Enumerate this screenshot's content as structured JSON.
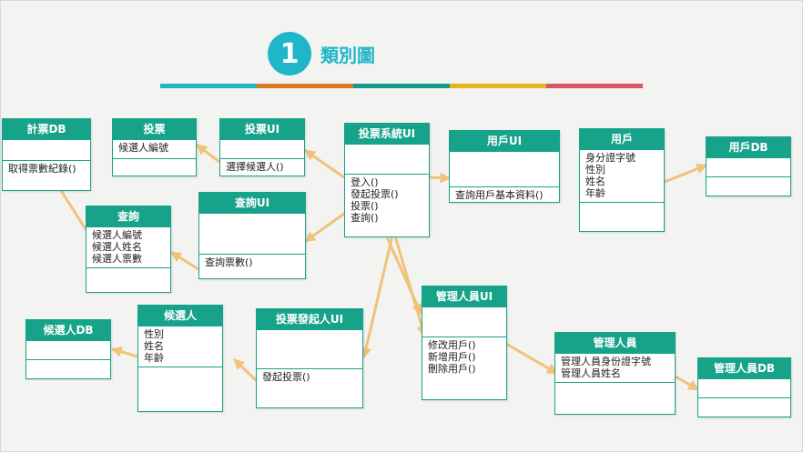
{
  "title": {
    "number": "1",
    "text": "類別圖"
  },
  "title_bar_colors": [
    "#1fb6c9",
    "#d97a1e",
    "#17998a",
    "#e5b51d",
    "#d9556a"
  ],
  "colors": {
    "class_header": "#17a389",
    "link_line": "#f0c27a"
  },
  "classes": {
    "jipiao_db": {
      "name": "計票DB",
      "attrs": [],
      "methods": [
        "取得票數紀錄()"
      ]
    },
    "toupiao": {
      "name": "投票",
      "attrs": [
        "候選人編號"
      ],
      "methods": []
    },
    "toupiao_ui": {
      "name": "投票UI",
      "attrs": [],
      "methods": [
        "選擇候選人()"
      ]
    },
    "toupiao_system": {
      "name": "投票系統UI",
      "attrs": [],
      "methods": [
        "登入()",
        "發起投票()",
        "投票()",
        "查詢()"
      ]
    },
    "yonghu_ui": {
      "name": "用戶UI",
      "attrs": [],
      "methods": [
        "查詢用戶基本資料()"
      ]
    },
    "yonghu": {
      "name": "用戶",
      "attrs": [
        "身分證字號",
        "性別",
        "姓名",
        "年齡"
      ],
      "methods": []
    },
    "yonghu_db": {
      "name": "用戶DB",
      "attrs": [],
      "methods": []
    },
    "chaxun": {
      "name": "查詢",
      "attrs": [
        "候選人編號",
        "候選人姓名",
        "候選人票數"
      ],
      "methods": []
    },
    "chaxun_ui": {
      "name": "查詢UI",
      "attrs": [],
      "methods": [
        "查詢票數()"
      ]
    },
    "houxuanren_db": {
      "name": "候選人DB",
      "attrs": [],
      "methods": []
    },
    "houxuanren": {
      "name": "候選人",
      "attrs": [
        "性別",
        "姓名",
        "年齡"
      ],
      "methods": []
    },
    "faqiren_ui": {
      "name": "投票發起人UI",
      "attrs": [],
      "methods": [
        "發起投票()"
      ]
    },
    "guanli_ui": {
      "name": "管理人員UI",
      "attrs": [],
      "methods": [
        "修改用戶()",
        "新增用戶()",
        "刪除用戶()"
      ]
    },
    "guanli": {
      "name": "管理人員",
      "attrs": [
        "管理人員身份證字號",
        "管理人員姓名"
      ],
      "methods": []
    },
    "guanli_db": {
      "name": "管理人員DB",
      "attrs": [],
      "methods": []
    }
  }
}
